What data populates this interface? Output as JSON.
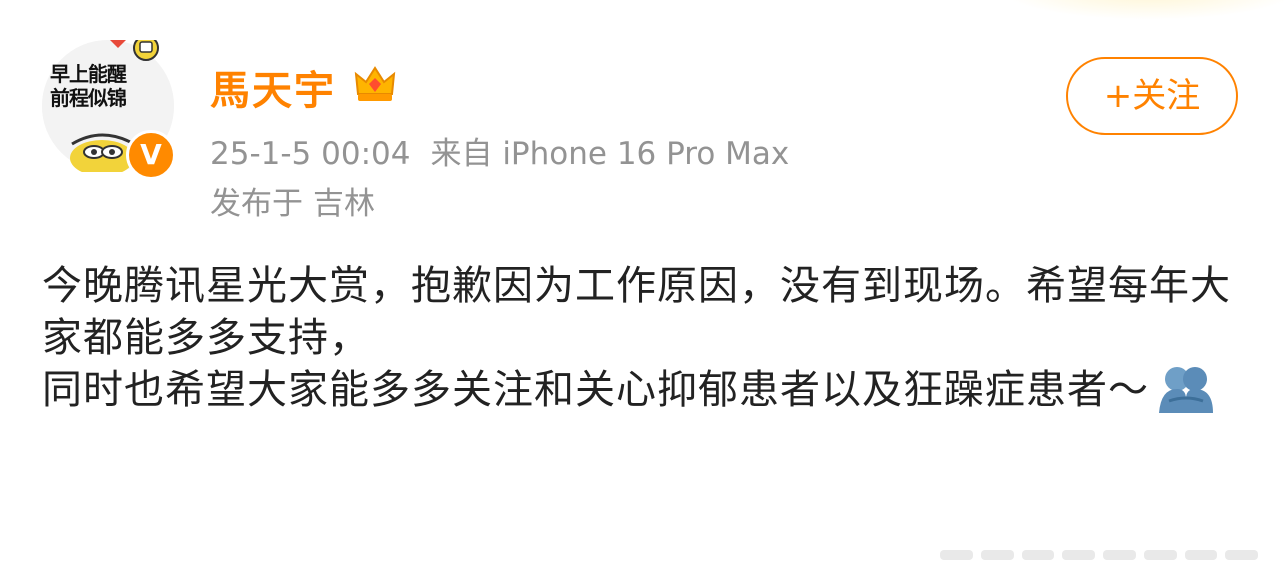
{
  "avatar": {
    "text_line1": "早上能醒",
    "text_line2": "前程似锦",
    "badge": "V",
    "icon": "verified-badge-icon"
  },
  "user": {
    "name": "馬天宇",
    "crown_icon": "crown-icon"
  },
  "meta": {
    "time": "25-1-5 00:04",
    "source": "来自 iPhone 16 Pro Max",
    "location_prefix": "发布于",
    "location": "吉林"
  },
  "follow_button": {
    "label": "+关注"
  },
  "post": {
    "line1": "今晚腾讯星光大赏，抱歉因为工作原因，没有到现场。希望每年大家都能多多支持，",
    "line2": "同时也希望大家能多多关注和关心抑郁患者以及狂躁症患者～",
    "emoji": "hug-emoji-icon"
  },
  "colors": {
    "accent": "#ff8200",
    "meta_text": "#939393",
    "body_text": "#222222",
    "background": "#ffffff"
  }
}
